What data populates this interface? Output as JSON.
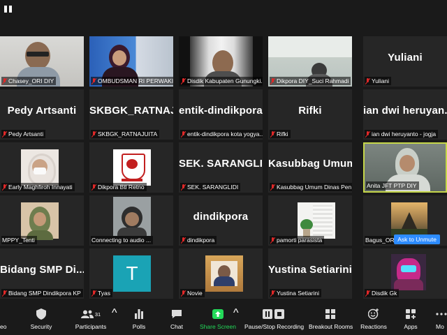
{
  "toolbar": {
    "video_label": "eo",
    "security_label": "Security",
    "participants_label": "Participants",
    "participants_count": "31",
    "polls_label": "Polls",
    "chat_label": "Chat",
    "share_label": "Share Screen",
    "recording_label": "Pause/Stop Recording",
    "breakout_label": "Breakout Rooms",
    "reactions_label": "Reactions",
    "apps_label": "Apps",
    "more_label": "Mo"
  },
  "tiles": [
    {
      "label": "Chasey_ORI DIY",
      "name": ""
    },
    {
      "label": "OMBUDSMAN RI PERWAKIL...",
      "name": ""
    },
    {
      "label": "Disdik Kabupaten Gunungki...",
      "name": ""
    },
    {
      "label": "Dikpora DIY_Suci Rahmadi",
      "name": ""
    },
    {
      "label": "Yuliani",
      "name": "Yuliani"
    },
    {
      "label": "Pedy Artsanti",
      "name": "Pedy Artsanti"
    },
    {
      "label": "SKBGK_RATNAJUITA",
      "name": "SKBGK_RATNAJ..."
    },
    {
      "label": "entik-dindikpora kota yogya...",
      "name": "entik-dindikpora..."
    },
    {
      "label": "Rifki",
      "name": "Rifki"
    },
    {
      "label": "ian dwi heruyanto - jogja",
      "name": "ian dwi heruyan..."
    },
    {
      "label": "Early Maghfiroh Innayati",
      "name": ""
    },
    {
      "label": "Dikpora Btl Retno",
      "name": ""
    },
    {
      "label": "SEK. SARANGLIDI",
      "name": "SEK. SARANGLIDI"
    },
    {
      "label": "Kasubbag Umum Dinas Pen...",
      "name": "Kasubbag Umum..."
    },
    {
      "label": "Anita JFT PTP DIY",
      "name": ""
    },
    {
      "label": "MPPY_Tenti",
      "name": ""
    },
    {
      "label": "Connecting to audio ...",
      "name": ""
    },
    {
      "label": "dindikpora",
      "name": "dindikpora"
    },
    {
      "label": "pamorti parasista",
      "name": ""
    },
    {
      "label": "Bagus_ORIJogja",
      "name": ""
    },
    {
      "label": "Bidang SMP Dindikpora KP",
      "name": "Bidang SMP Di..."
    },
    {
      "label": "Tyas",
      "name": ""
    },
    {
      "label": "Novie",
      "name": ""
    },
    {
      "label": "Yustina Setiarini",
      "name": "Yustina Setiarini"
    },
    {
      "label": "Disdik Gk",
      "name": ""
    }
  ],
  "tyas_avatar_letter": "T",
  "ask_to_unmute": "Ask to Unmute",
  "accent_active": "#c6d74a",
  "accent_share": "#23d959",
  "accent_unmute": "#2d8cff",
  "muted_color": "#e02828"
}
